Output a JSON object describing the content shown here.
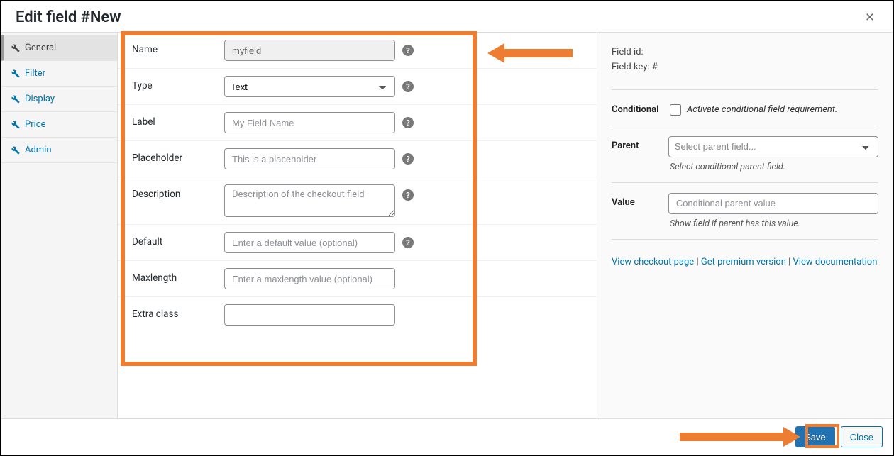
{
  "header": {
    "title": "Edit field #New"
  },
  "sidebar": {
    "items": [
      {
        "label": "General",
        "active": true
      },
      {
        "label": "Filter",
        "active": false
      },
      {
        "label": "Display",
        "active": false
      },
      {
        "label": "Price",
        "active": false
      },
      {
        "label": "Admin",
        "active": false
      }
    ]
  },
  "form": {
    "name": {
      "label": "Name",
      "value": "myfield"
    },
    "type": {
      "label": "Type",
      "selected": "Text"
    },
    "label_field": {
      "label": "Label",
      "placeholder": "My Field Name"
    },
    "placeholder": {
      "label": "Placeholder",
      "placeholder": "This is a placeholder"
    },
    "description": {
      "label": "Description",
      "placeholder": "Description of the checkout field"
    },
    "default": {
      "label": "Default",
      "placeholder": "Enter a default value (optional)"
    },
    "maxlength": {
      "label": "Maxlength",
      "placeholder": "Enter a maxlength value (optional)"
    },
    "extra_class": {
      "label": "Extra class"
    }
  },
  "right": {
    "field_id_label": "Field id:",
    "field_key_label": "Field key: #",
    "conditional": {
      "label": "Conditional",
      "check_label": "Activate conditional field requirement."
    },
    "parent": {
      "label": "Parent",
      "placeholder": "Select parent field...",
      "helper": "Select conditional parent field."
    },
    "value": {
      "label": "Value",
      "placeholder": "Conditional parent value",
      "helper": "Show field if parent has this value."
    },
    "links": {
      "checkout": "View checkout page",
      "premium": "Get premium version",
      "docs": "View documentation"
    }
  },
  "footer": {
    "save": "Save",
    "close": "Close"
  },
  "annotation_color": "#ed7d31"
}
